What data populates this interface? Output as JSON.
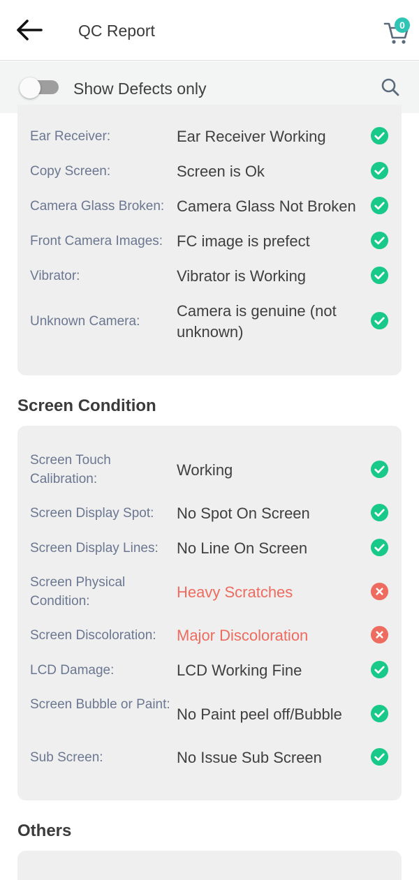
{
  "header": {
    "title": "QC Report",
    "cart_count": "0"
  },
  "filter": {
    "toggle_label": "Show Defects only"
  },
  "sections": {
    "top": {
      "rows": [
        {
          "label": "Ear Receiver:",
          "value": "Ear Receiver Working",
          "status": "ok"
        },
        {
          "label": "Copy Screen:",
          "value": "Screen is Ok",
          "status": "ok"
        },
        {
          "label": "Camera Glass Broken:",
          "value": "Camera Glass Not Broken",
          "status": "ok"
        },
        {
          "label": "Front Camera Images:",
          "value": "FC image is prefect",
          "status": "ok"
        },
        {
          "label": "Vibrator:",
          "value": "Vibrator is Working",
          "status": "ok"
        },
        {
          "label": "Unknown Camera:",
          "value": "Camera is genuine (not unknown)",
          "status": "ok"
        }
      ]
    },
    "screen": {
      "title": "Screen Condition",
      "rows": [
        {
          "label": "Screen Touch Calibration:",
          "value": "Working",
          "status": "ok"
        },
        {
          "label": "Screen Display Spot:",
          "value": "No Spot On Screen",
          "status": "ok"
        },
        {
          "label": "Screen Display Lines:",
          "value": "No Line On Screen",
          "status": "ok"
        },
        {
          "label": "Screen Physical Condition:",
          "value": "Heavy Scratches",
          "status": "defect"
        },
        {
          "label": "Screen Discoloration:",
          "value": "Major Discoloration",
          "status": "defect"
        },
        {
          "label": "LCD Damage:",
          "value": "LCD Working Fine",
          "status": "ok"
        },
        {
          "label": "Screen Bubble or Paint:",
          "value": "No Paint peel off/Bubble",
          "status": "ok"
        },
        {
          "label": "Sub Screen:",
          "value": "No Issue Sub Screen",
          "status": "ok"
        }
      ]
    },
    "others": {
      "title": "Others"
    }
  },
  "colors": {
    "ok": "#19c98a",
    "defect": "#ee6b5f",
    "accent": "#2ec4b6"
  },
  "icons": {
    "ok": "check-circle-icon",
    "defect": "x-circle-icon"
  }
}
